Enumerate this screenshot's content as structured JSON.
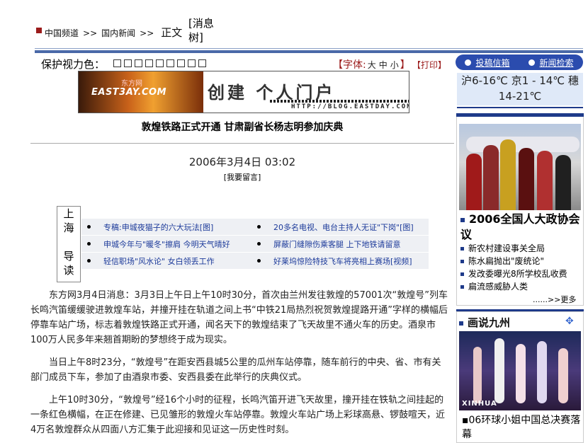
{
  "breadcrumb": {
    "items": [
      "中国频道",
      "国内新闻"
    ],
    "separator": ">>",
    "current": "正文",
    "source": "[消息树]"
  },
  "toolbar": {
    "eye_label": "保护视力色：",
    "swatch_count": 9,
    "font_label": "【字体:",
    "font_sizes": [
      "大",
      "中",
      "小"
    ],
    "font_close": "】",
    "print_label": "【打印】"
  },
  "right_nav": {
    "items": [
      "投稿信箱",
      "新闻检索"
    ]
  },
  "weather": {
    "text": "沪6-16℃ 京1 - 14℃ 穗14-21℃"
  },
  "banner": {
    "logo": "EAST3AY.COM",
    "logo_cn": "东方网",
    "headline": "创建 个人门户",
    "url": "HTTP://BLOG.EASTDAY.COM"
  },
  "article": {
    "title": "敦煌铁路正式开通 甘肃副省长杨志明参加庆典",
    "date": "2006年3月4日 03:02",
    "comment": "[我要留言]",
    "paragraphs": [
      "东方网3月4日消息：3月3日上午日上午10时30分，首次由兰州发往敦煌的57001次“敦煌号”列车长鸣汽笛缓缓驶进敦煌车站，并撞开挂在轨道之间上书“中铁21局热烈祝贺敦煌提路开通”字样的横幅后停靠车站广场，标志着敦煌铁路正式开通，闻名天下的敦煌结束了飞天故里不通火车的历史。酒泉市100万人民多年来翘首期盼的梦想终于成为现实。",
      "当日上午8时23分，“敦煌号”在距安西县城5公里的瓜州车站停靠，随车前行的中央、省、市有关部门成员下车，参加了由酒泉市委、安西县委在此举行的庆典仪式。",
      "上午10时30分，“敦煌号”经16个小时的征程，长鸣汽笛开进飞天故里，撞开挂在铁轨之间挂起的一条红色横幅，在正在修建、已见雏形的敦煌火车站停靠。敦煌火车站广场上彩球高悬、锣鼓喧天，近4万名敦煌群众从四面八方汇集于此迎接和见证这一历史性时刻。"
    ]
  },
  "guide": {
    "label": [
      "上",
      "海",
      "导",
      "读"
    ],
    "rows": [
      [
        "专稿:申城夜猫子的六大玩法[图]",
        "20多名电视、电台主持人无证\"下岗\"[图]"
      ],
      [
        "申城今年与\"暖冬\"擦肩 今明天气晴好",
        "屏蔽门缝隙伤乘客腿 上下地铁请留意"
      ],
      [
        "轻信职场\"风水论\" 女白领丢工作",
        "好莱坞惊险特技飞车将亮相上赛场[视频]"
      ]
    ]
  },
  "sidebar": {
    "feature_title": "2006全国人大政协会议",
    "feature_items": [
      "新农村建设事关全局",
      "陈水扁抛出\"废统论\"",
      "发改委曝光8所学校乱收费",
      "扁流感威胁人类"
    ],
    "more": "......>>更多",
    "gallery_title": "画说九州",
    "gallery_watermark": "XINHUA",
    "gallery_caption": "▪06环球小姐中国总决赛落幕"
  },
  "colors": {
    "accent_blue": "#2b4cae",
    "dark_blue": "#1e3a8a",
    "accent_red": "#9b1b1b",
    "link_blue": "#1c3a9a"
  }
}
